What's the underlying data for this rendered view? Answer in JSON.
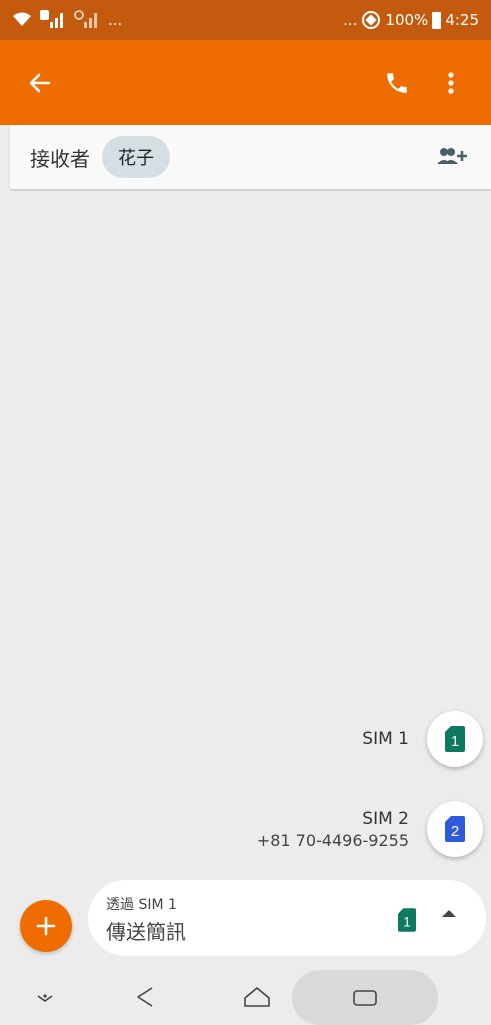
{
  "status_bar": {
    "ellipsis_left": "...",
    "ellipsis_right": "...",
    "battery_text": "100%",
    "time": "4:25"
  },
  "app_bar": {
    "color": "#ef6c00"
  },
  "recipient": {
    "label": "接收者",
    "chip": "花子"
  },
  "sim_options": [
    {
      "name": "SIM 1",
      "badge": "1",
      "color": "#0d7a5f"
    },
    {
      "name": "SIM 2",
      "number": "+81 70-4496-9255",
      "badge": "2",
      "color": "#2d5bdc"
    }
  ],
  "compose": {
    "via": "透過 SIM 1",
    "placeholder": "傳送簡訊",
    "sim_badge": "1"
  },
  "icons": {
    "back": "arrow-left-icon",
    "call": "phone-icon",
    "more": "more-vert-icon",
    "add_person": "add-person-icon",
    "add": "plus-icon"
  }
}
